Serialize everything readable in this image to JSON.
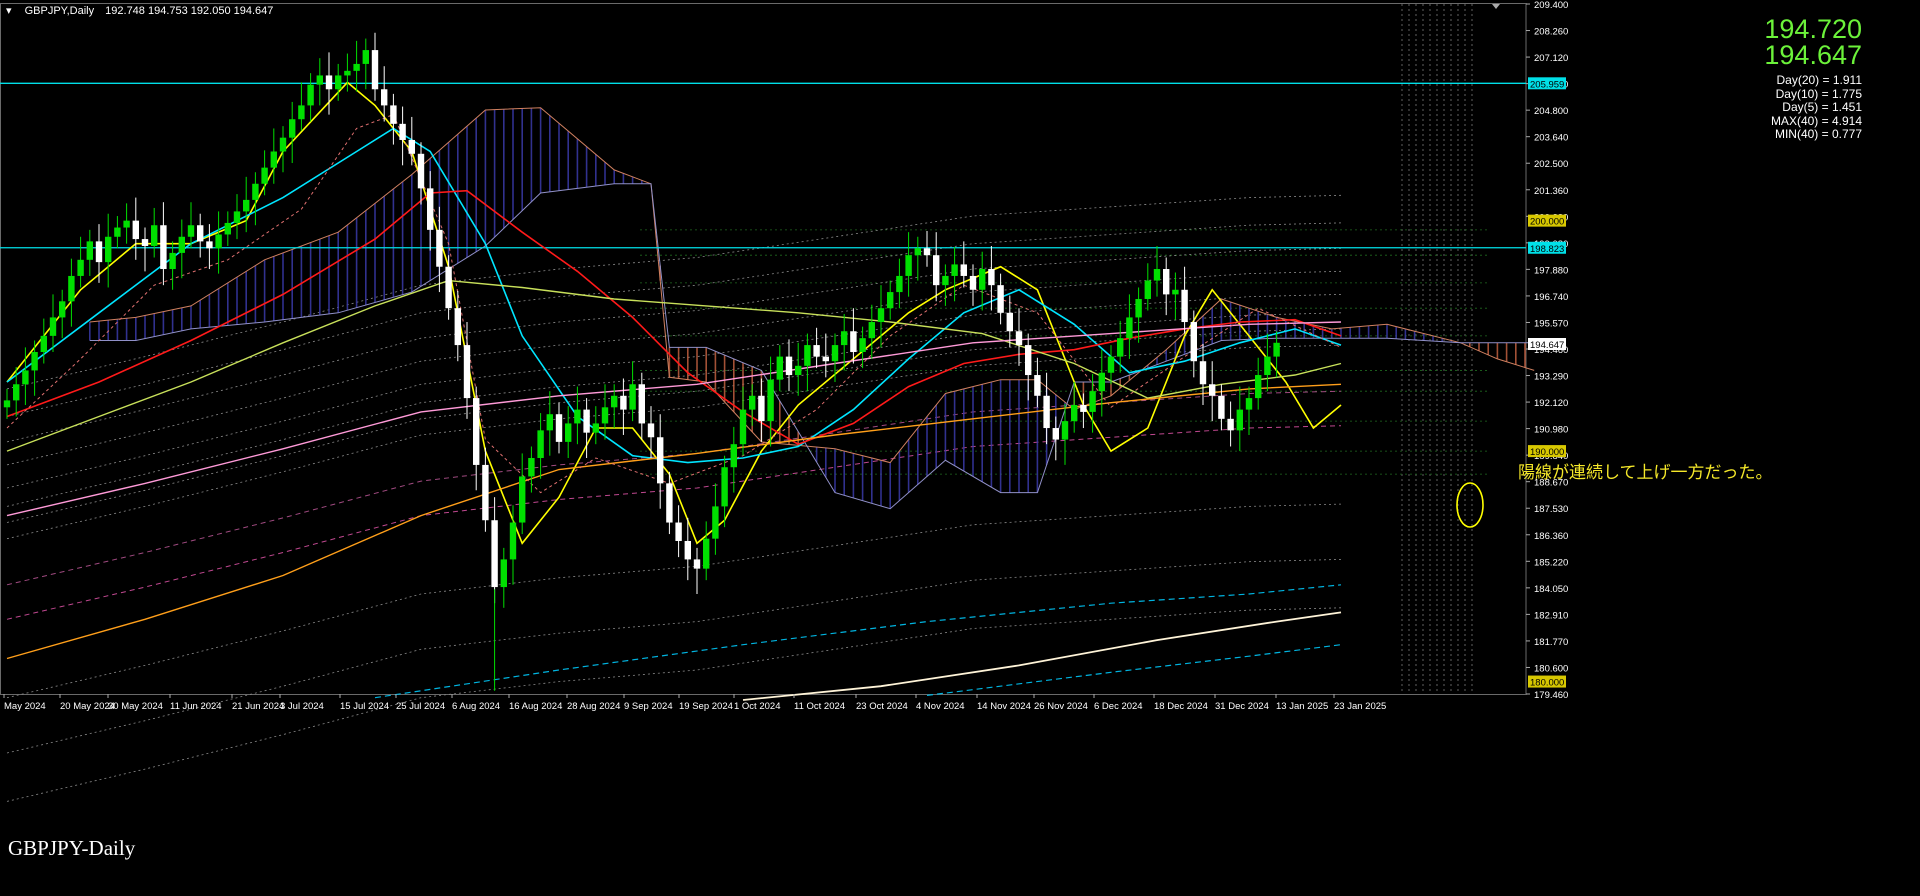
{
  "header": {
    "symbol": "GBPJPY,Daily",
    "ohlc": "192.748 194.753 192.050 194.647"
  },
  "info_panel": {
    "bid": "194.720",
    "ask": "194.647",
    "stats": [
      "Day(20) = 1.911",
      "Day(10) = 1.775",
      "Day(5) = 1.451",
      "MAX(40) = 4.914",
      "MIN(40) = 0.777"
    ]
  },
  "watermark": "GBPJPY-Daily",
  "annotation": "陽線が連続して上げ一方だった。",
  "colors": {
    "background": "#000000",
    "bull_candle": "#00e000",
    "bear_candle": "#ffffff",
    "ma_yellow": "#ffff00",
    "ma_cyan": "#00e5ff",
    "ma_red": "#ff1a1a",
    "ma_olive": "#c8e05a",
    "ma_pink": "#ff9ad8",
    "ma_orange": "#ff9f1a",
    "ma_cream": "#fff4d8",
    "ma_teal_dashed": "#00b4e0",
    "kumo_bull": "#3a3aa8",
    "kumo_bear": "#c06040",
    "hline_cyan": "#00e0e8"
  },
  "chart_data": {
    "type": "candlestick",
    "ylim": [
      179.46,
      209.4
    ],
    "y_ticks": [
      "209.400",
      "208.260",
      "207.120",
      "205.980",
      "204.800",
      "203.640",
      "202.500",
      "201.360",
      "200.220",
      "199.080",
      "197.880",
      "196.740",
      "195.570",
      "194.460",
      "193.290",
      "192.120",
      "190.980",
      "189.840",
      "188.670",
      "187.530",
      "186.360",
      "185.220",
      "184.050",
      "182.910",
      "181.770",
      "180.600",
      "179.460"
    ],
    "x_ticks": [
      "May 2024",
      "20 May 2024",
      "30 May 2024",
      "11 Jun 2024",
      "21 Jun 2024",
      "3 Jul 2024",
      "15 Jul 2024",
      "25 Jul 2024",
      "6 Aug 2024",
      "16 Aug 2024",
      "28 Aug 2024",
      "9 Sep 2024",
      "19 Sep 2024",
      "1 Oct 2024",
      "11 Oct 2024",
      "23 Oct 2024",
      "4 Nov 2024",
      "14 Nov 2024",
      "26 Nov 2024",
      "6 Dec 2024",
      "18 Dec 2024",
      "31 Dec 2024",
      "13 Jan 2025",
      "23 Jan 2025"
    ],
    "price_labels": [
      {
        "value": "205.959",
        "price": 205.959,
        "color": "#00e0e8"
      },
      {
        "value": "200.000",
        "price": 200.0,
        "color": "#d8c800"
      },
      {
        "value": "198.823",
        "price": 198.823,
        "color": "#00e0e8"
      },
      {
        "value": "194.647",
        "price": 194.647,
        "color": "#ffffff"
      },
      {
        "value": "190.000",
        "price": 190.0,
        "color": "#d8c800"
      },
      {
        "value": "180.000",
        "price": 180.0,
        "color": "#d8c800"
      }
    ],
    "horizontal_lines": [
      205.959,
      198.823
    ],
    "closes": [
      192.2,
      192.9,
      193.5,
      194.3,
      195.0,
      195.8,
      196.5,
      197.6,
      198.3,
      199.1,
      198.2,
      199.3,
      199.7,
      200.0,
      199.2,
      198.9,
      199.8,
      197.9,
      198.6,
      199.3,
      199.8,
      199.1,
      198.8,
      199.4,
      199.9,
      200.4,
      200.9,
      201.6,
      202.3,
      203.0,
      203.6,
      204.4,
      205.0,
      205.9,
      206.3,
      205.7,
      206.3,
      206.5,
      206.8,
      207.4,
      205.7,
      205.0,
      204.2,
      203.5,
      202.9,
      201.4,
      199.6,
      198.0,
      196.2,
      194.6,
      192.3,
      189.4,
      187.0,
      184.1,
      185.3,
      186.9,
      188.9,
      189.7,
      190.9,
      191.6,
      190.4,
      191.2,
      191.8,
      190.8,
      191.2,
      191.9,
      192.4,
      191.8,
      192.9,
      191.2,
      190.6,
      188.6,
      186.9,
      186.1,
      185.3,
      184.9,
      186.2,
      187.6,
      189.3,
      190.3,
      191.8,
      192.4,
      191.3,
      193.1,
      194.1,
      193.3,
      193.7,
      194.6,
      194.1,
      193.9,
      194.6,
      195.2,
      194.3,
      194.9,
      195.6,
      196.2,
      196.9,
      197.6,
      198.5,
      198.8,
      198.5,
      197.2,
      197.6,
      198.1,
      197.6,
      197.0,
      197.9,
      197.2,
      196.0,
      195.2,
      194.6,
      193.3,
      192.4,
      191.0,
      190.5,
      191.3,
      192.0,
      191.7,
      192.6,
      193.4,
      194.1,
      194.9,
      195.8,
      196.6,
      197.4,
      197.9,
      196.8,
      197.0,
      195.6,
      193.9,
      192.9,
      192.4,
      191.4,
      190.9,
      191.8,
      192.3,
      193.3,
      194.1,
      194.7
    ],
    "series": [
      {
        "type": "line",
        "color": "#ffff00",
        "width": 1.6,
        "dash": "",
        "points": [
          [
            0,
            193
          ],
          [
            8,
            197
          ],
          [
            14,
            199
          ],
          [
            20,
            199
          ],
          [
            26,
            200
          ],
          [
            30,
            203
          ],
          [
            37,
            206
          ],
          [
            40,
            205
          ],
          [
            44,
            203
          ],
          [
            48,
            198
          ],
          [
            52,
            190
          ],
          [
            56,
            186
          ],
          [
            60,
            188
          ],
          [
            64,
            191
          ],
          [
            68,
            191
          ],
          [
            72,
            189
          ],
          [
            75,
            186
          ],
          [
            78,
            187
          ],
          [
            82,
            190
          ],
          [
            86,
            192
          ],
          [
            92,
            194
          ],
          [
            98,
            196
          ],
          [
            102,
            197
          ],
          [
            108,
            198
          ],
          [
            112,
            197
          ],
          [
            115,
            194
          ],
          [
            117,
            192
          ],
          [
            120,
            190
          ],
          [
            124,
            191
          ],
          [
            128,
            195
          ],
          [
            131,
            197
          ],
          [
            135,
            195
          ],
          [
            139,
            193
          ],
          [
            142,
            191
          ],
          [
            145,
            192
          ]
        ]
      },
      {
        "type": "line",
        "color": "#00e5ff",
        "width": 1.6,
        "dash": "",
        "points": [
          [
            0,
            193
          ],
          [
            10,
            196
          ],
          [
            20,
            199
          ],
          [
            30,
            201
          ],
          [
            38,
            203
          ],
          [
            42,
            204
          ],
          [
            46,
            203
          ],
          [
            52,
            199
          ],
          [
            56,
            195
          ],
          [
            62,
            191.5
          ],
          [
            68,
            189.8
          ],
          [
            74,
            189.5
          ],
          [
            80,
            189.7
          ],
          [
            86,
            190.2
          ],
          [
            92,
            191.8
          ],
          [
            98,
            194
          ],
          [
            104,
            196
          ],
          [
            110,
            197
          ],
          [
            116,
            195.5
          ],
          [
            122,
            193.4
          ],
          [
            128,
            193.9
          ],
          [
            134,
            194.7
          ],
          [
            140,
            195.3
          ],
          [
            145,
            194.6
          ]
        ]
      },
      {
        "type": "line",
        "color": "#ff1a1a",
        "width": 1.6,
        "dash": "",
        "points": [
          [
            0,
            191.5
          ],
          [
            10,
            193
          ],
          [
            20,
            194.8
          ],
          [
            30,
            196.8
          ],
          [
            40,
            199.2
          ],
          [
            46,
            201.2
          ],
          [
            50,
            201.3
          ],
          [
            56,
            199.5
          ],
          [
            62,
            197.8
          ],
          [
            68,
            195.8
          ],
          [
            74,
            193.4
          ],
          [
            80,
            191.7
          ],
          [
            86,
            190.3
          ],
          [
            92,
            191.2
          ],
          [
            98,
            192.8
          ],
          [
            104,
            193.8
          ],
          [
            110,
            194.2
          ],
          [
            116,
            194.4
          ],
          [
            122,
            194.9
          ],
          [
            128,
            195.3
          ],
          [
            134,
            195.6
          ],
          [
            140,
            195.7
          ],
          [
            145,
            195
          ]
        ]
      },
      {
        "type": "line",
        "color": "#c8e05a",
        "width": 1.4,
        "dash": "",
        "points": [
          [
            0,
            190
          ],
          [
            10,
            191.5
          ],
          [
            20,
            193
          ],
          [
            30,
            194.7
          ],
          [
            40,
            196.3
          ],
          [
            48,
            197.4
          ],
          [
            56,
            197.1
          ],
          [
            66,
            196.6
          ],
          [
            76,
            196.3
          ],
          [
            86,
            196.0
          ],
          [
            96,
            195.6
          ],
          [
            106,
            195.1
          ],
          [
            116,
            193.8
          ],
          [
            124,
            192.3
          ],
          [
            132,
            192.9
          ],
          [
            140,
            193.3
          ],
          [
            145,
            193.8
          ]
        ]
      },
      {
        "type": "line",
        "color": "#ff9ad8",
        "width": 1.4,
        "dash": "",
        "points": [
          [
            0,
            187.2
          ],
          [
            15,
            188.6
          ],
          [
            30,
            190.1
          ],
          [
            45,
            191.7
          ],
          [
            60,
            192.4
          ],
          [
            75,
            192.9
          ],
          [
            90,
            193.8
          ],
          [
            105,
            194.7
          ],
          [
            120,
            195.1
          ],
          [
            135,
            195.5
          ],
          [
            145,
            195.6
          ]
        ]
      },
      {
        "type": "line",
        "color": "#ff9f1a",
        "width": 1.4,
        "dash": "",
        "points": [
          [
            0,
            181
          ],
          [
            15,
            182.7
          ],
          [
            30,
            184.6
          ],
          [
            45,
            187.2
          ],
          [
            60,
            189.2
          ],
          [
            75,
            189.9
          ],
          [
            90,
            190.7
          ],
          [
            105,
            191.4
          ],
          [
            120,
            192.1
          ],
          [
            135,
            192.7
          ],
          [
            145,
            192.9
          ]
        ]
      },
      {
        "type": "line",
        "color": "#fff4d8",
        "width": 1.8,
        "dash": "",
        "points": [
          [
            80,
            179.2
          ],
          [
            95,
            179.8
          ],
          [
            110,
            180.7
          ],
          [
            125,
            181.8
          ],
          [
            138,
            182.6
          ],
          [
            145,
            183
          ]
        ]
      },
      {
        "type": "line",
        "color": "#00b4e0",
        "width": 1.2,
        "dash": "6 4",
        "points": [
          [
            40,
            179.3
          ],
          [
            60,
            180.5
          ],
          [
            80,
            181.6
          ],
          [
            100,
            182.6
          ],
          [
            120,
            183.4
          ],
          [
            135,
            183.8
          ],
          [
            145,
            184.2
          ]
        ]
      },
      {
        "type": "line",
        "color": "#00b4e0",
        "width": 1.2,
        "dash": "6 4",
        "points": [
          [
            100,
            179.4
          ],
          [
            120,
            180.4
          ],
          [
            135,
            181.1
          ],
          [
            145,
            181.6
          ]
        ]
      },
      {
        "type": "line",
        "color": "#e07070",
        "width": 1,
        "dash": "3 3",
        "points": [
          [
            0,
            191
          ],
          [
            8,
            194
          ],
          [
            16,
            197.2
          ],
          [
            24,
            198.3
          ],
          [
            32,
            200.5
          ],
          [
            38,
            204
          ],
          [
            42,
            204.6
          ],
          [
            48,
            199
          ],
          [
            52,
            190.5
          ],
          [
            58,
            188.2
          ],
          [
            64,
            189.7
          ],
          [
            72,
            188.6
          ],
          [
            80,
            189.8
          ],
          [
            88,
            191.8
          ],
          [
            96,
            195
          ],
          [
            104,
            197.2
          ],
          [
            112,
            196
          ],
          [
            120,
            191.9
          ],
          [
            128,
            194.1
          ],
          [
            136,
            196.2
          ],
          [
            145,
            194.5
          ]
        ]
      }
    ],
    "kumo": {
      "spanA": [
        [
          9,
          195.6
        ],
        [
          14,
          195.8
        ],
        [
          20,
          196.3
        ],
        [
          28,
          198.3
        ],
        [
          36,
          199.5
        ],
        [
          44,
          202.0
        ],
        [
          52,
          204.8
        ],
        [
          58,
          204.9
        ],
        [
          66,
          202.2
        ],
        [
          70,
          201.6
        ],
        [
          72,
          193.2
        ],
        [
          76,
          193.0
        ],
        [
          82,
          190.4
        ],
        [
          90,
          190.1
        ],
        [
          96,
          189.5
        ],
        [
          102,
          192.5
        ],
        [
          108,
          193.1
        ],
        [
          112,
          193.1
        ],
        [
          116,
          191.8
        ],
        [
          120,
          192.4
        ],
        [
          126,
          194.4
        ],
        [
          132,
          196.6
        ],
        [
          138,
          195.8
        ],
        [
          144,
          195.3
        ],
        [
          150,
          195.5
        ],
        [
          158,
          194.7
        ],
        [
          162,
          194.0
        ],
        [
          166,
          193.5
        ]
      ],
      "spanB": [
        [
          9,
          194.8
        ],
        [
          14,
          194.8
        ],
        [
          20,
          195.3
        ],
        [
          28,
          195.6
        ],
        [
          36,
          196.0
        ],
        [
          44,
          196.9
        ],
        [
          52,
          198.9
        ],
        [
          58,
          201.2
        ],
        [
          66,
          201.6
        ],
        [
          70,
          201.6
        ],
        [
          72,
          194.5
        ],
        [
          76,
          194.5
        ],
        [
          82,
          193.5
        ],
        [
          90,
          188.2
        ],
        [
          96,
          187.5
        ],
        [
          102,
          189.6
        ],
        [
          108,
          188.2
        ],
        [
          112,
          188.2
        ],
        [
          116,
          193.0
        ],
        [
          120,
          193.0
        ],
        [
          126,
          193.9
        ],
        [
          132,
          194.8
        ],
        [
          138,
          194.9
        ],
        [
          144,
          194.9
        ],
        [
          150,
          194.9
        ],
        [
          158,
          194.7
        ],
        [
          162,
          194.7
        ],
        [
          166,
          194.7
        ]
      ]
    },
    "bands_upper": [
      201.1,
      199.9,
      198.8,
      197.8,
      196.8,
      196.0,
      195.3,
      194.6
    ],
    "bands_lower": [
      187.7,
      185.3,
      183.2
    ]
  }
}
